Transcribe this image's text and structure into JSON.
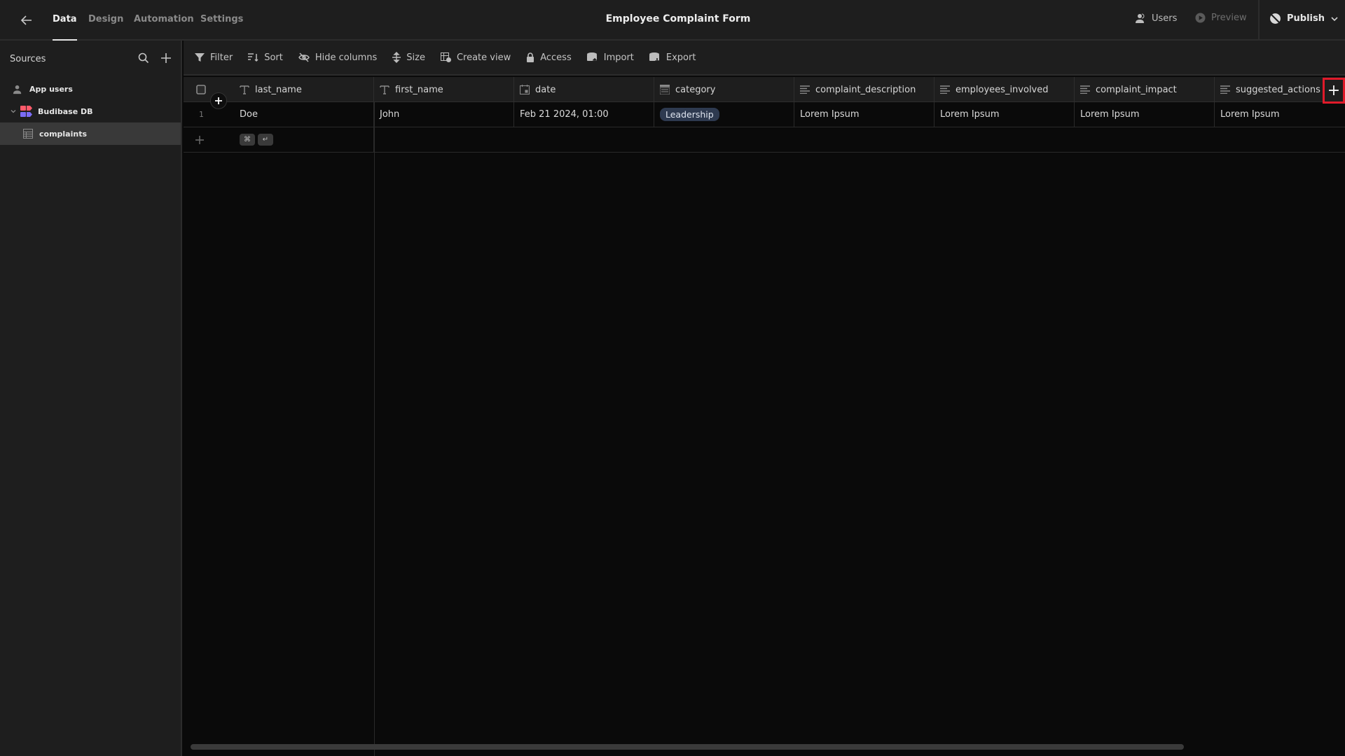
{
  "topbar": {
    "back_icon": "arrow-left-icon",
    "tabs": [
      {
        "label": "Data",
        "active": true
      },
      {
        "label": "Design",
        "active": false
      },
      {
        "label": "Automation",
        "active": false
      },
      {
        "label": "Settings",
        "active": false
      }
    ],
    "title": "Employee Complaint Form",
    "users_label": "Users",
    "preview_label": "Preview",
    "publish_label": "Publish"
  },
  "sidebar": {
    "heading": "Sources",
    "items": [
      {
        "label": "App users",
        "icon": "users-icon"
      },
      {
        "label": "Budibase DB",
        "icon": "budibase-db-icon",
        "expanded": true
      },
      {
        "label": "complaints",
        "icon": "table-icon",
        "selected": true
      }
    ]
  },
  "toolbar": {
    "filter": "Filter",
    "sort": "Sort",
    "hide_columns": "Hide columns",
    "size": "Size",
    "create_view": "Create view",
    "access": "Access",
    "import": "Import",
    "export": "Export"
  },
  "table": {
    "columns": [
      {
        "name": "last_name",
        "type": "text"
      },
      {
        "name": "first_name",
        "type": "text"
      },
      {
        "name": "date",
        "type": "datetime"
      },
      {
        "name": "category",
        "type": "options"
      },
      {
        "name": "complaint_description",
        "type": "longform"
      },
      {
        "name": "employees_involved",
        "type": "longform"
      },
      {
        "name": "complaint_impact",
        "type": "longform"
      },
      {
        "name": "suggested_actions",
        "type": "longform"
      }
    ],
    "rows": [
      {
        "index": "1",
        "last_name": "Doe",
        "first_name": "John",
        "date": "Feb 21 2024, 01:00",
        "category": "Leadership",
        "complaint_description": "Lorem Ipsum",
        "employees_involved": "Lorem Ipsum",
        "complaint_impact": "Lorem Ipsum",
        "suggested_actions": "Lorem Ipsum"
      }
    ],
    "new_row_shortcut": [
      "⌘",
      "↵"
    ],
    "add_column_label": "+"
  },
  "colors": {
    "highlight": "#e01a2a",
    "badge_bg": "#2e3a50"
  }
}
